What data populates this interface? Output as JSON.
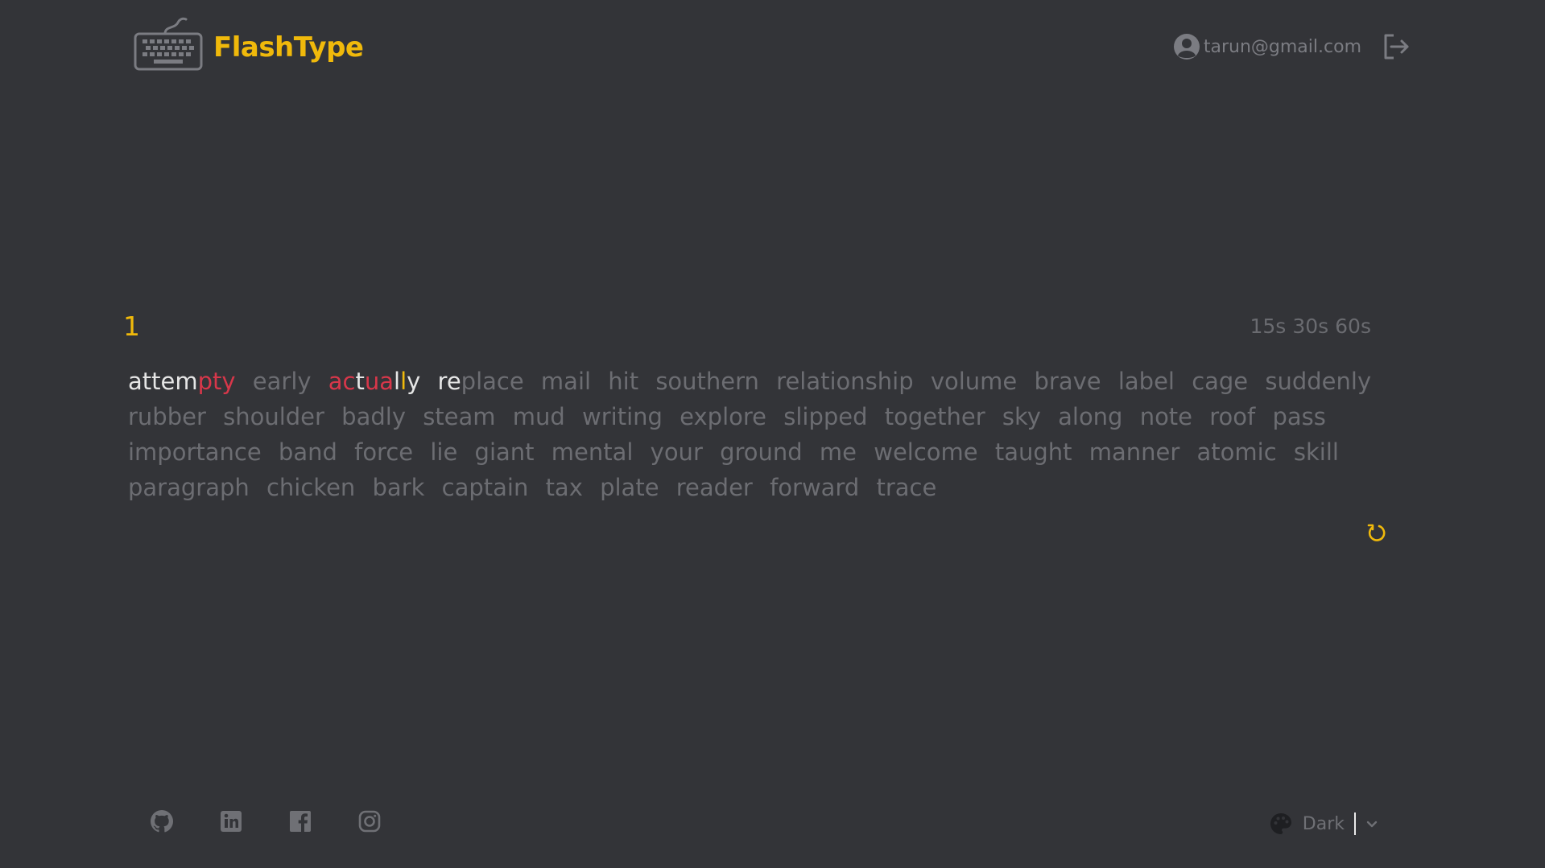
{
  "app": {
    "name": "FlashType",
    "brand_color": "#f0b90b"
  },
  "header": {
    "user_email": "tarun@gmail.com",
    "icons": [
      "keyboard-logo-icon",
      "user-avatar-icon",
      "logout-icon"
    ]
  },
  "test": {
    "counter": "1",
    "modes": [
      "15s",
      "30s",
      "60s"
    ],
    "typed": [
      {
        "word": "attempty",
        "segments": [
          {
            "text": "attem",
            "state": "correct"
          },
          {
            "text": "pt",
            "state": "incorrect"
          },
          {
            "text": "y",
            "state": "extra"
          }
        ]
      },
      {
        "word": "early",
        "segments": [
          {
            "text": "early",
            "state": "pending"
          }
        ]
      },
      {
        "word": "actually",
        "segments": [
          {
            "text": "ac",
            "state": "incorrect"
          },
          {
            "text": "t",
            "state": "correct"
          },
          {
            "text": "ua",
            "state": "incorrect"
          },
          {
            "text": "l",
            "state": "correct"
          },
          {
            "text": "l",
            "state": "incorrect-yellow"
          },
          {
            "text": "y",
            "state": "correct"
          }
        ]
      },
      {
        "word": "replace",
        "segments": [
          {
            "text": "re",
            "state": "correct"
          },
          {
            "text": "place",
            "state": "pending"
          }
        ]
      }
    ],
    "remaining_words": [
      "mail",
      "hit",
      "southern",
      "relationship",
      "volume",
      "brave",
      "label",
      "cage",
      "suddenly",
      "rubber",
      "shoulder",
      "badly",
      "steam",
      "mud",
      "writing",
      "explore",
      "slipped",
      "together",
      "sky",
      "along",
      "note",
      "roof",
      "pass",
      "importance",
      "band",
      "force",
      "lie",
      "giant",
      "mental",
      "your",
      "ground",
      "me",
      "welcome",
      "taught",
      "manner",
      "atomic",
      "skill",
      "paragraph",
      "chicken",
      "bark",
      "captain",
      "tax",
      "plate",
      "reader",
      "forward",
      "trace"
    ],
    "colors": {
      "correct": "#e6e6e6",
      "incorrect": "#d7374a",
      "pending": "#6c6d72"
    }
  },
  "footer": {
    "socials": [
      "github-icon",
      "linkedin-icon",
      "facebook-icon",
      "instagram-icon"
    ],
    "theme_label": "Dark"
  }
}
